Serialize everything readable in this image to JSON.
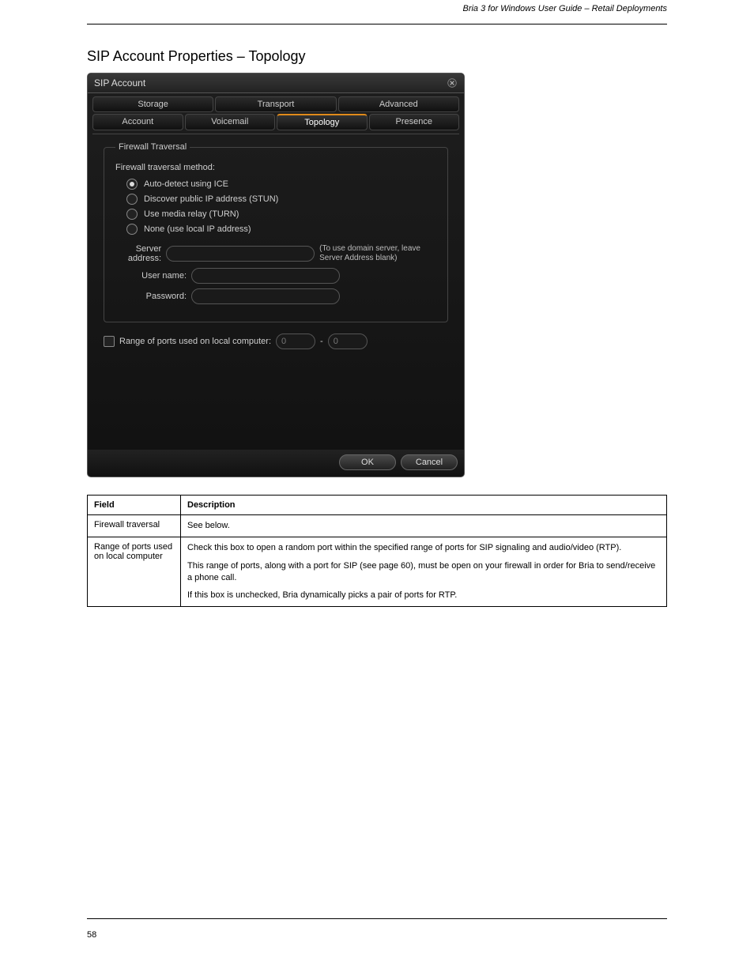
{
  "header": {
    "running_title": "Bria 3 for Windows User Guide – Retail Deployments"
  },
  "section": {
    "heading": "SIP Account Properties – Topology"
  },
  "dialog": {
    "title": "SIP Account",
    "tabs_row1": [
      "Storage",
      "Transport",
      "Advanced"
    ],
    "tabs_row2": [
      "Account",
      "Voicemail",
      "Topology",
      "Presence"
    ],
    "selected_tab": "Topology",
    "firewall": {
      "legend": "Firewall Traversal",
      "method_label": "Firewall traversal method:",
      "options": [
        "Auto-detect using ICE",
        "Discover public IP address (STUN)",
        "Use media relay (TURN)",
        "None (use local IP address)"
      ],
      "selected_option": 0,
      "server_label": "Server address:",
      "server_value": "",
      "server_hint": "(To use domain server, leave Server Address blank)",
      "username_label": "User name:",
      "username_value": "",
      "password_label": "Password:",
      "password_value": ""
    },
    "ports": {
      "checkbox_label": "Range of ports used on local computer:",
      "from": "0",
      "dash": "-",
      "to": "0"
    },
    "buttons": {
      "ok": "OK",
      "cancel": "Cancel"
    }
  },
  "table": {
    "colheaders": [
      "Field",
      "Description"
    ],
    "rows": [
      {
        "field": "Firewall traversal",
        "desc": [
          "See below."
        ]
      },
      {
        "field": "Range of ports used on local computer",
        "desc": [
          "Check this box to open a random port within the specified range of ports for SIP signaling and audio/video (RTP).",
          "This range of ports, along with a port for SIP (see page 60), must be open on your firewall in order for Bria to send/receive a phone call.",
          "If this box is unchecked, Bria dynamically picks a pair of ports for RTP."
        ]
      }
    ]
  },
  "footer": {
    "page": "58"
  }
}
